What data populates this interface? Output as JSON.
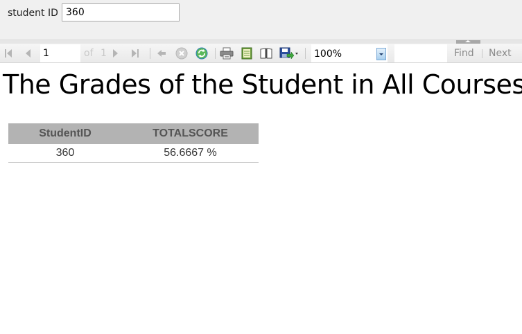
{
  "parameters": {
    "label": "student ID",
    "value": "360"
  },
  "toolbar": {
    "current_page": "1",
    "of_label": "of",
    "total_pages": "1",
    "zoom": "100%",
    "find_value": "",
    "find_label": "Find",
    "next_label": "Next",
    "icons": [
      "first-page-icon",
      "previous-page-icon",
      "next-page-icon",
      "last-page-icon",
      "back-icon",
      "stop-icon",
      "refresh-icon",
      "print-icon",
      "print-layout-icon",
      "page-setup-icon",
      "export-icon"
    ]
  },
  "report": {
    "title": "The Grades of the Student in All Courses.",
    "columns": [
      "StudentID",
      "TOTALSCORE"
    ],
    "rows": [
      [
        "360",
        "56.6667 %"
      ]
    ]
  },
  "colors": {
    "header_bg": "#b3b3b3",
    "header_text": "#555555",
    "param_bg": "#f0f0f0"
  }
}
